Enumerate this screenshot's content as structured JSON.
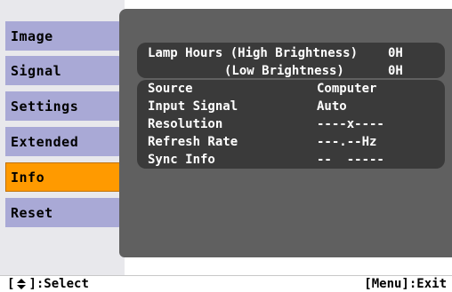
{
  "menu": {
    "tabs": [
      {
        "label": "Image"
      },
      {
        "label": "Signal"
      },
      {
        "label": "Settings"
      },
      {
        "label": "Extended"
      },
      {
        "label": "Info",
        "active": true
      },
      {
        "label": "Reset"
      }
    ]
  },
  "info": {
    "lamp_hours_label": "Lamp Hours (High Brightness)",
    "lamp_hours_high": "0H",
    "lamp_low_label": "(Low Brightness)",
    "lamp_hours_low": "0H",
    "source_label": "Source",
    "source_value": "Computer",
    "input_signal_label": "Input Signal",
    "input_signal_value": "Auto",
    "resolution_label": "Resolution",
    "resolution_value": "----x----",
    "refresh_rate_label": "Refresh Rate",
    "refresh_rate_value": "---.--Hz",
    "sync_info_label": "Sync Info",
    "sync_info_value": "--  -----"
  },
  "footer": {
    "select_bracket_open": "[",
    "select_text": "]:Select",
    "exit_text": "[Menu]:Exit"
  },
  "colors": {
    "tab": "#a9a9d6",
    "tab_active": "#ff9a00",
    "panel": "#606060",
    "infobox": "#3a3a3a"
  }
}
